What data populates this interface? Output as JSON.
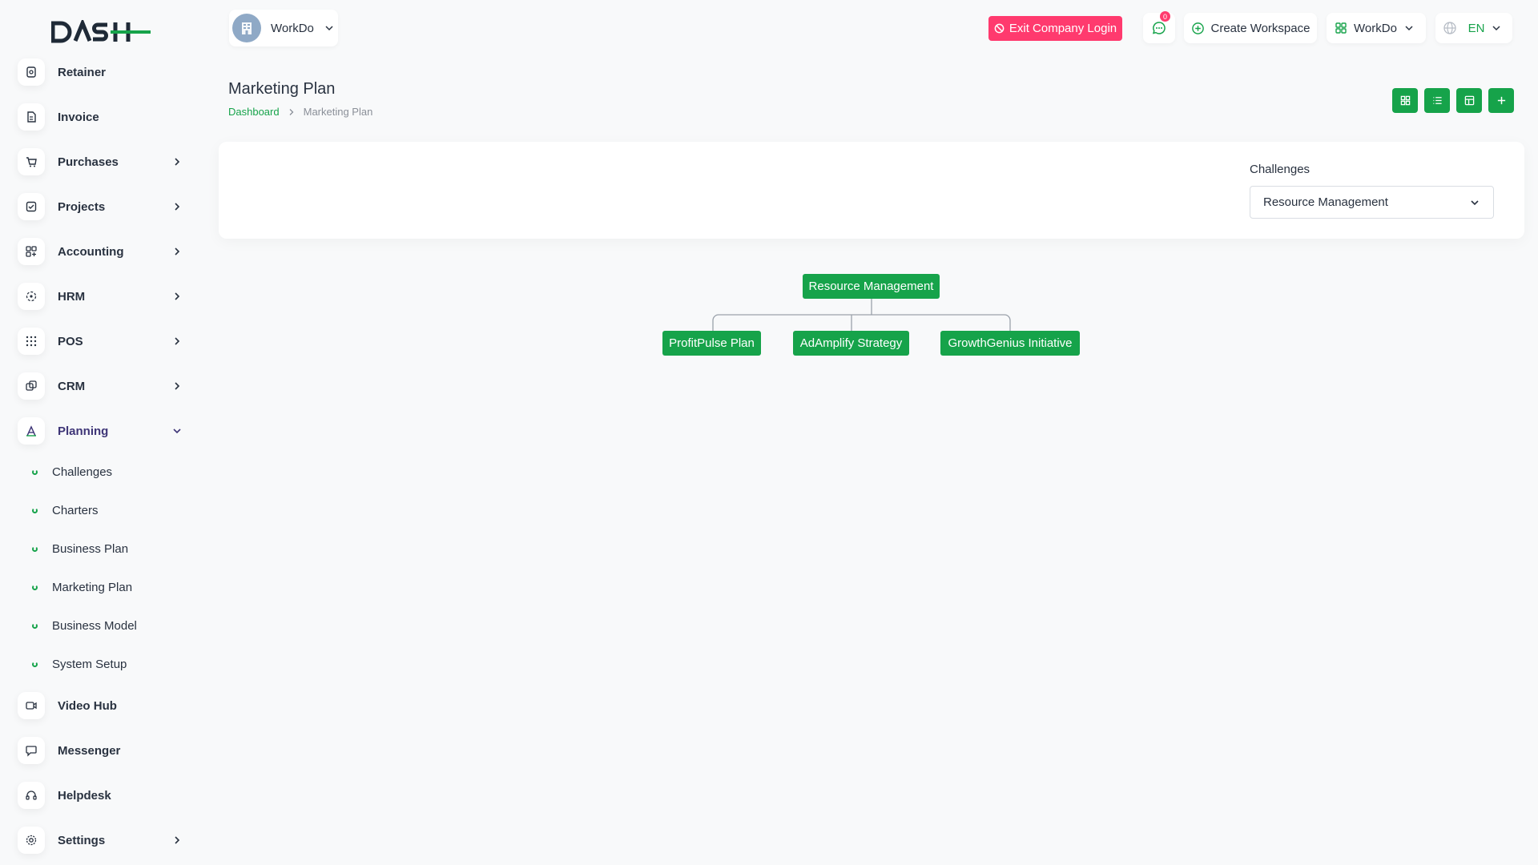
{
  "brand": {
    "logo_text": "DASH",
    "accent": "#16a34a",
    "danger": "#ff3a6e"
  },
  "sidebar": {
    "items": [
      {
        "label": "Retainer",
        "icon": "retainer-icon",
        "has_children": false
      },
      {
        "label": "Invoice",
        "icon": "invoice-icon",
        "has_children": false
      },
      {
        "label": "Purchases",
        "icon": "cart-icon",
        "has_children": true
      },
      {
        "label": "Projects",
        "icon": "checkbox-icon",
        "has_children": true
      },
      {
        "label": "Accounting",
        "icon": "grid-plus-icon",
        "has_children": true
      },
      {
        "label": "HRM",
        "icon": "hrm-icon",
        "has_children": true
      },
      {
        "label": "POS",
        "icon": "dots-grid-icon",
        "has_children": true
      },
      {
        "label": "CRM",
        "icon": "crm-icon",
        "has_children": true
      },
      {
        "label": "Planning",
        "icon": "planning-icon",
        "has_children": true,
        "expanded": true
      },
      {
        "label": "Video Hub",
        "icon": "video-icon",
        "has_children": false
      },
      {
        "label": "Messenger",
        "icon": "chat-icon",
        "has_children": false
      },
      {
        "label": "Helpdesk",
        "icon": "headset-icon",
        "has_children": false
      },
      {
        "label": "Settings",
        "icon": "gear-icon",
        "has_children": true
      }
    ],
    "planning_children": [
      "Challenges",
      "Charters",
      "Business Plan",
      "Marketing Plan",
      "Business Model",
      "System Setup"
    ]
  },
  "header": {
    "workspace_name": "WorkDo",
    "exit_label": "Exit Company Login",
    "notification_count": "0",
    "create_workspace_label": "Create Workspace",
    "workspace_menu_label": "WorkDo",
    "language": "EN"
  },
  "page": {
    "title": "Marketing Plan",
    "breadcrumb_home": "Dashboard",
    "breadcrumb_current": "Marketing Plan"
  },
  "filter": {
    "label": "Challenges",
    "selected": "Resource Management"
  },
  "tree": {
    "root": "Resource Management",
    "children": [
      "ProfitPulse Plan",
      "AdAmplify Strategy",
      "GrowthGenius Initiative"
    ]
  }
}
